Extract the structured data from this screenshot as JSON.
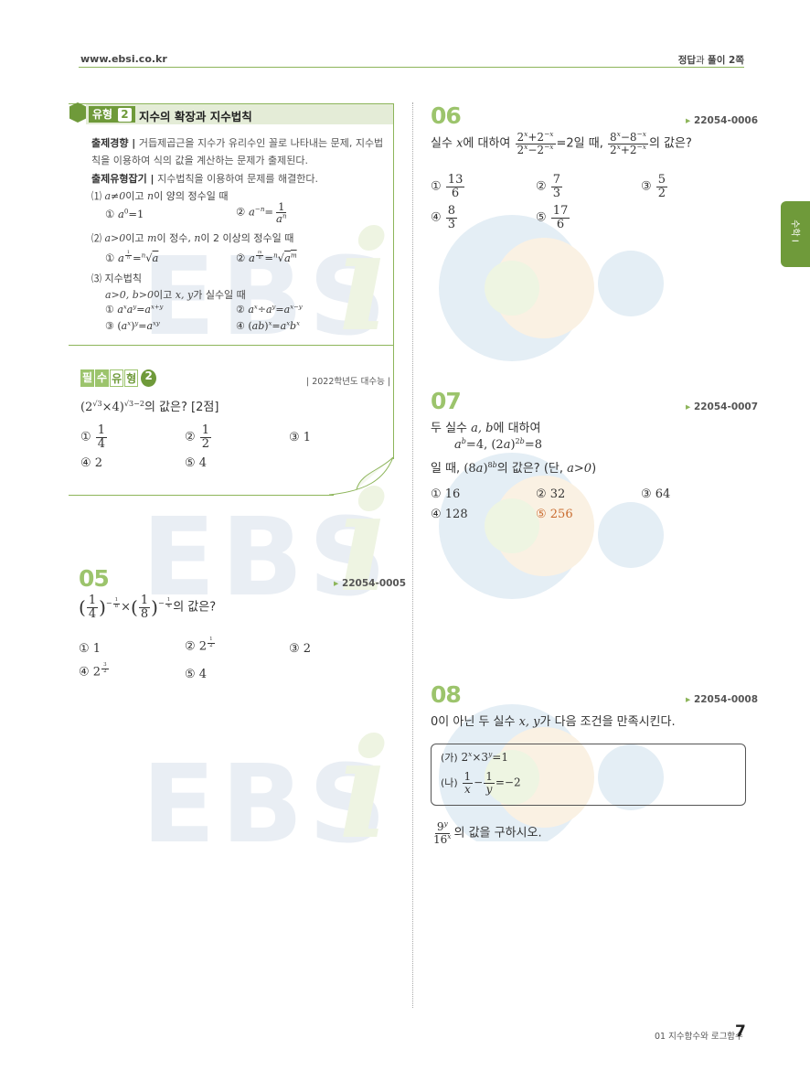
{
  "header": {
    "site": "www.ebsi.co.kr",
    "answer_ref_a": "정답",
    "answer_ref_b": "과 ",
    "answer_ref_c": "풀이 2쪽"
  },
  "side_tab": {
    "label": "수학 Ⅰ",
    "color": "#6f9a3a"
  },
  "watermark": "EBS",
  "colors": {
    "accent_green": "#8db55a",
    "number_green": "#9cc46c",
    "box_green": "#6f9a3a"
  },
  "type2": {
    "badge": "유형",
    "badge_num": "2",
    "title": "지수의 확장과 지수법칙",
    "trend_label": "출제경향 |",
    "trend_text": "거듭제곱근을 지수가 유리수인 꼴로 나타내는 문제, 지수법칙을 이용하여 식의 값을 계산하는 문제가 출제된다.",
    "grasp_label": "출제유형잡기 |",
    "grasp_text": "지수법칙을 이용하여 문제를 해결한다.",
    "c1_head_a": "⑴ ",
    "c1_head_b": "a≠0",
    "c1_head_c": "이고 ",
    "c1_head_d": "n",
    "c1_head_e": "이 양의 정수일 때",
    "c2_head_a": "⑵ ",
    "c2_head_b": "a>0",
    "c2_head_c": "이고 ",
    "c2_head_d": "m",
    "c2_head_e": "이 정수, ",
    "c2_head_f": "n",
    "c2_head_g": "이 2 이상의 정수일 때",
    "c3_head": "⑶ 지수법칙",
    "c3_cond_a": "a>0, b>0",
    "c3_cond_b": "이고 ",
    "c3_cond_c": "x, y",
    "c3_cond_d": "가 실수일 때"
  },
  "must_type": {
    "c1": "필",
    "c2": "수",
    "c3": "유",
    "c4": "형",
    "num": "2",
    "source": "| 2022학년도 대수능 |",
    "points": "[2점]",
    "suffix": "의 값은?",
    "options": [
      "① 1/4",
      "② 1/2",
      "③ 1",
      "④ 2",
      "⑤ 4"
    ]
  },
  "q05": {
    "number": "05",
    "code": "22054-0005",
    "suffix": "의 값은?",
    "options": [
      "① 1",
      "② 2^(1/2)",
      "③ 2",
      "④ 2^(3/2)",
      "⑤ 4"
    ]
  },
  "q06": {
    "number": "06",
    "code": "22054-0006",
    "stem_a": "실수 ",
    "stem_b": "x",
    "stem_c": "에 대하여 ",
    "stem_d": "=2일 때, ",
    "stem_e": "의 값은?",
    "options": [
      "① 13/6",
      "② 7/3",
      "③ 5/2",
      "④ 8/3",
      "⑤ 17/6"
    ]
  },
  "q07": {
    "number": "07",
    "code": "22054-0007",
    "stem_a": "두 실수 ",
    "stem_b": "a, b",
    "stem_c": "에 대하여",
    "line3_a": "일 때, ",
    "line3_b": "의 값은? (단, ",
    "line3_c": "a>0",
    "line3_d": ")",
    "options": [
      "① 16",
      "② 32",
      "③ 64",
      "④ 128",
      "⑤ 256"
    ]
  },
  "q08": {
    "number": "08",
    "code": "22054-0008",
    "stem_a": "0이 아닌 두 실수 ",
    "stem_b": "x, y",
    "stem_c": "가 다음 조건을 만족시킨다.",
    "cond_a_label": "(가)",
    "cond_b_label": "(나)",
    "ask": "의 값을 구하시오."
  },
  "footer": {
    "chapter": "01 지수함수와 로그함수",
    "page": "7"
  }
}
